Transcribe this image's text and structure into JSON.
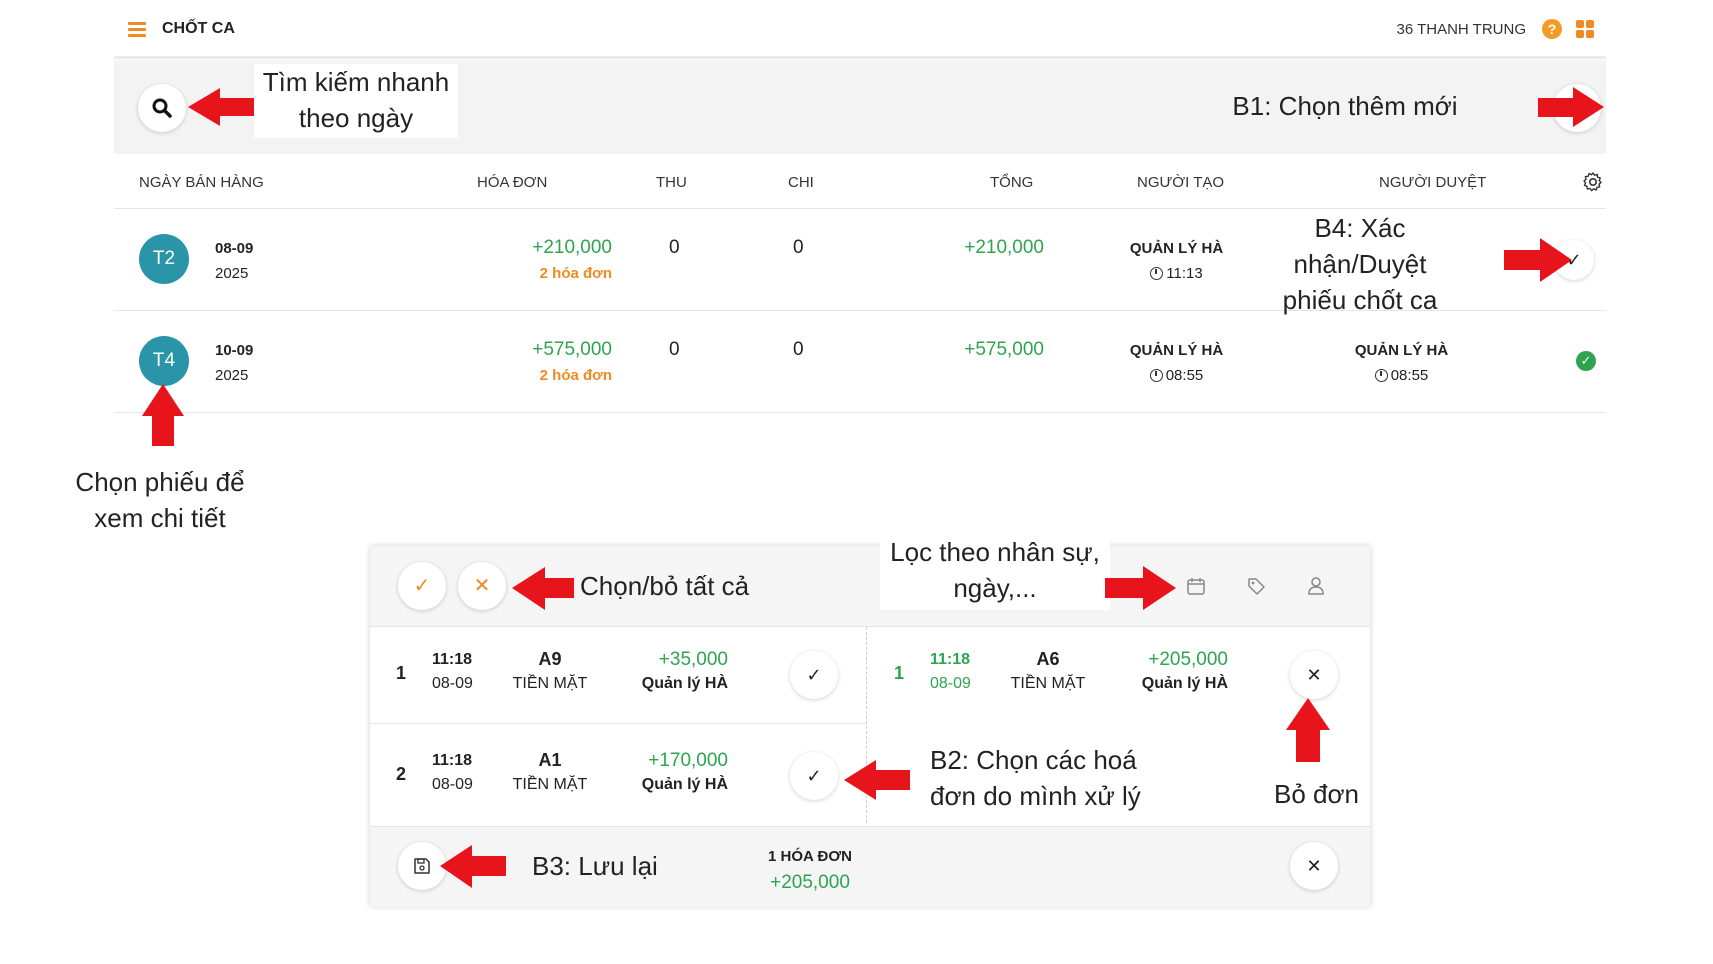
{
  "header": {
    "title": "CHỐT CA",
    "user": "36 THANH TRUNG",
    "help": "?"
  },
  "annotations": {
    "search": [
      "Tìm kiếm nhanh",
      "theo ngày"
    ],
    "add": "B1: Chọn thêm mới",
    "approve": [
      "B4: Xác nhận/Duyệt",
      "phiếu chốt ca"
    ],
    "select_ticket": [
      "Chọn phiếu để",
      "xem chi tiết"
    ],
    "select_all": "Chọn/bỏ tất cả",
    "filter": [
      "Lọc theo nhân sự,",
      "ngày,..."
    ],
    "choose_invoices": [
      "B2: Chọn các hoá",
      "đơn do mình xử lý"
    ],
    "remove": "Bỏ đơn",
    "save": "B3: Lưu lại"
  },
  "table": {
    "columns": [
      "NGÀY BÁN HÀNG",
      "HÓA ĐƠN",
      "THU",
      "CHI",
      "TỔNG",
      "NGƯỜI TẠO",
      "NGƯỜI DUYỆT"
    ],
    "rows": [
      {
        "weekday": "T2",
        "date": "08-09",
        "year": "2025",
        "amount": "+210,000",
        "invoices": "2 hóa đơn",
        "thu": "0",
        "chi": "0",
        "total": "+210,000",
        "creator": "QUẢN LÝ HÀ",
        "created_time": "11:13",
        "approver": "",
        "approved_time": "",
        "status": "pending"
      },
      {
        "weekday": "T4",
        "date": "10-09",
        "year": "2025",
        "amount": "+575,000",
        "invoices": "2 hóa đơn",
        "thu": "0",
        "chi": "0",
        "total": "+575,000",
        "creator": "QUẢN LÝ HÀ",
        "created_time": "08:55",
        "approver": "QUẢN LÝ HÀ",
        "approved_time": "08:55",
        "status": "approved"
      }
    ]
  },
  "panel": {
    "invoices": [
      {
        "index": "1",
        "time": "11:18",
        "date": "08-09",
        "code": "A9",
        "method": "TIỀN MẶT",
        "amount": "+35,000",
        "staff": "Quản lý HÀ",
        "selected": false
      },
      {
        "index": "1",
        "time": "11:18",
        "date": "08-09",
        "code": "A6",
        "method": "TIỀN MẶT",
        "amount": "+205,000",
        "staff": "Quản lý HÀ",
        "selected": true
      },
      {
        "index": "2",
        "time": "11:18",
        "date": "08-09",
        "code": "A1",
        "method": "TIỀN MẶT",
        "amount": "+170,000",
        "staff": "Quản lý HÀ",
        "selected": false
      }
    ],
    "summary": {
      "count": "1 HÓA ĐƠN",
      "total": "+205,000"
    }
  },
  "colors": {
    "accent": "#f08a24",
    "green": "#2ea44f",
    "avatar": "#2a95a8",
    "arrow": "#e8141c"
  }
}
